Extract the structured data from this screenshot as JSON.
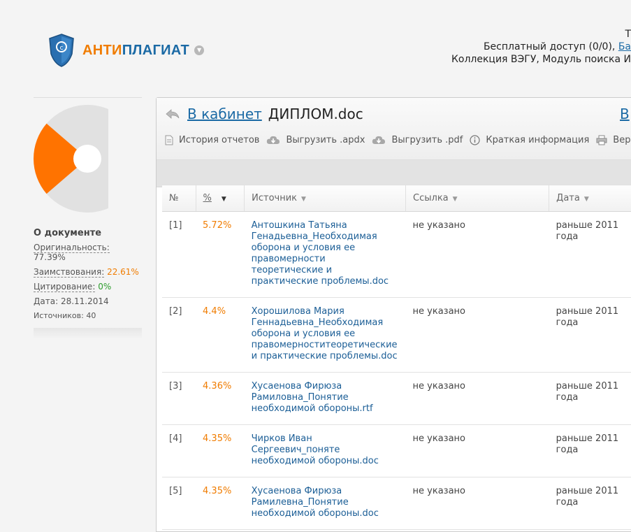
{
  "logo": {
    "part1": "АНТИ",
    "part2": "ПЛАГИАТ",
    "icon": "shield-copyright-icon",
    "dropdown_icon": "chevron-down-icon"
  },
  "header": {
    "line1": "Т",
    "line2_text": "Бесплатный доступ (0/0),",
    "line2_link": "Ба",
    "line3": "Коллекция ВЭГУ, Модуль поиска И"
  },
  "sidebar": {
    "about_title": "О документе",
    "originality_label": "Оригинальность:",
    "originality_value": "77.39%",
    "borrowing_label": "Заимствования:",
    "borrowing_value": "22.61%",
    "citation_label": "Цитирование:",
    "citation_value": "0%",
    "date_label": "Дата:",
    "date_value": "28.11.2014",
    "sources_label": "Источников:",
    "sources_value": "40",
    "chart": {
      "originality_pct": 77.39,
      "borrowing_pct": 22.61,
      "citation_pct": 0,
      "colors": {
        "originality": "#e1e1e1",
        "borrowing": "#ff7300"
      }
    }
  },
  "panel": {
    "back_link": "В кабинет",
    "file_name": "ДИПЛОМ.doc",
    "right_link": "В",
    "toolbar": {
      "history": "История отчетов",
      "export_apdx": "Выгрузить .apdx",
      "export_pdf": "Выгрузить .pdf",
      "brief_info": "Краткая информация",
      "version": "Верси"
    }
  },
  "table": {
    "headers": {
      "num": "№",
      "pct": "%",
      "source": "Источник",
      "link": "Ссылка",
      "date": "Дата"
    },
    "rows": [
      {
        "num": "[1]",
        "pct": "5.72%",
        "source": "Антошкина Татьяна Генадьевна_Необходимая оборона и условия ее правомерности теоретические и практические проблемы.doc",
        "link": "не указано",
        "date": "раньше 2011 года"
      },
      {
        "num": "[2]",
        "pct": "4.4%",
        "source": "Хорошилова Мария Геннадьевна_Необходимая оборона и условия ее правомерноститеоретические и практические проблемы.doc",
        "link": "не указано",
        "date": "раньше 2011 года"
      },
      {
        "num": "[3]",
        "pct": "4.36%",
        "source": "Хусаенова Фирюза Рамиловна_Понятие необходимой обороны.rtf",
        "link": "не указано",
        "date": "раньше 2011 года"
      },
      {
        "num": "[4]",
        "pct": "4.35%",
        "source": "Чирков Иван Сергеевич_поняте необходимой обороны.doc",
        "link": "не указано",
        "date": "раньше 2011 года"
      },
      {
        "num": "[5]",
        "pct": "4.35%",
        "source": "Хусаенова Фирюза Рамилевна_Понятие необходимой обороны.doc",
        "link": "не указано",
        "date": "раньше 2011 года"
      }
    ]
  }
}
